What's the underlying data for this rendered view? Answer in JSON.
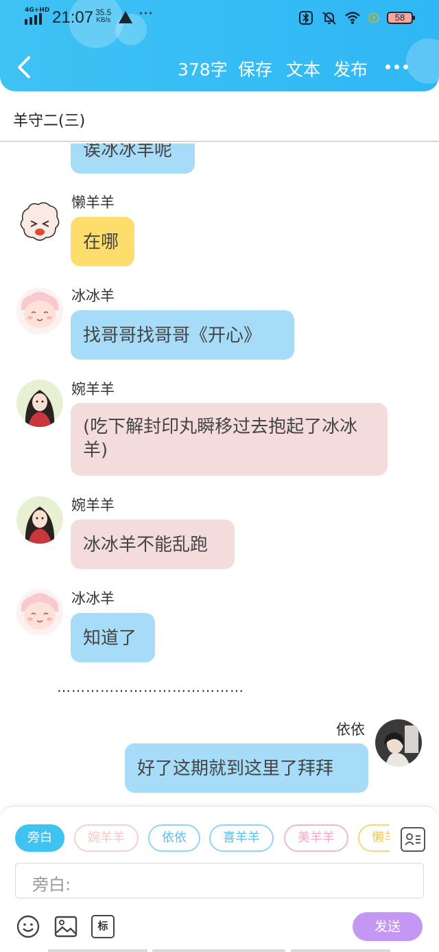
{
  "status_bar": {
    "network": "4G+HD",
    "time": "21:07",
    "speed": "35.5",
    "speed_unit": "KB/s",
    "more": "···",
    "battery": "58"
  },
  "toolbar": {
    "back_icon": "chevron-left-icon",
    "word_count": "378字",
    "save": "保存",
    "text": "文本",
    "publish": "发布",
    "more_icon": "more-dots-icon"
  },
  "title": "羊守二(三)",
  "messages": [
    {
      "speaker": "",
      "text": "诶冰冰羊呢",
      "side": "left",
      "color": "blue"
    },
    {
      "speaker": "懒羊羊",
      "text": "在哪",
      "side": "left",
      "color": "yellow"
    },
    {
      "speaker": "冰冰羊",
      "text": "找哥哥找哥哥《开心》",
      "side": "left",
      "color": "blue"
    },
    {
      "speaker": "婉羊羊",
      "text": "(吃下解封印丸瞬移过去抱起了冰冰羊)",
      "side": "left",
      "color": "pink"
    },
    {
      "speaker": "婉羊羊",
      "text": "冰冰羊不能乱跑",
      "side": "left",
      "color": "pink"
    },
    {
      "speaker": "冰冰羊",
      "text": "知道了",
      "side": "left",
      "color": "blue"
    },
    {
      "speaker": "",
      "text": "…………………………………",
      "side": "center",
      "color": "none"
    },
    {
      "speaker": "依依",
      "text": "好了这期就到这里了拜拜",
      "side": "right",
      "color": "blue"
    }
  ],
  "characters": [
    {
      "label": "旁白",
      "selected": true,
      "color": "#3ec3f3"
    },
    {
      "label": "婉羊羊",
      "selected": false,
      "color": "#f1c9c9"
    },
    {
      "label": "依依",
      "selected": false,
      "color": "#8fd4f5"
    },
    {
      "label": "喜羊羊",
      "selected": false,
      "color": "#8fd4f5"
    },
    {
      "label": "美羊羊",
      "selected": false,
      "color": "#f4a9c0"
    },
    {
      "label": "懒羊",
      "selected": false,
      "color": "#f3d87a"
    }
  ],
  "input": {
    "placeholder": "旁白:"
  },
  "tools": [
    "emoji-icon",
    "image-icon",
    "tag-icon"
  ],
  "tag_label": "标",
  "send": "发送",
  "colors": {
    "header": "#2fb7f5",
    "bubble_blue": "#a7dcf8",
    "bubble_yellow": "#fddd6b",
    "bubble_pink": "#f4dcdc",
    "send": "#c397f3"
  }
}
